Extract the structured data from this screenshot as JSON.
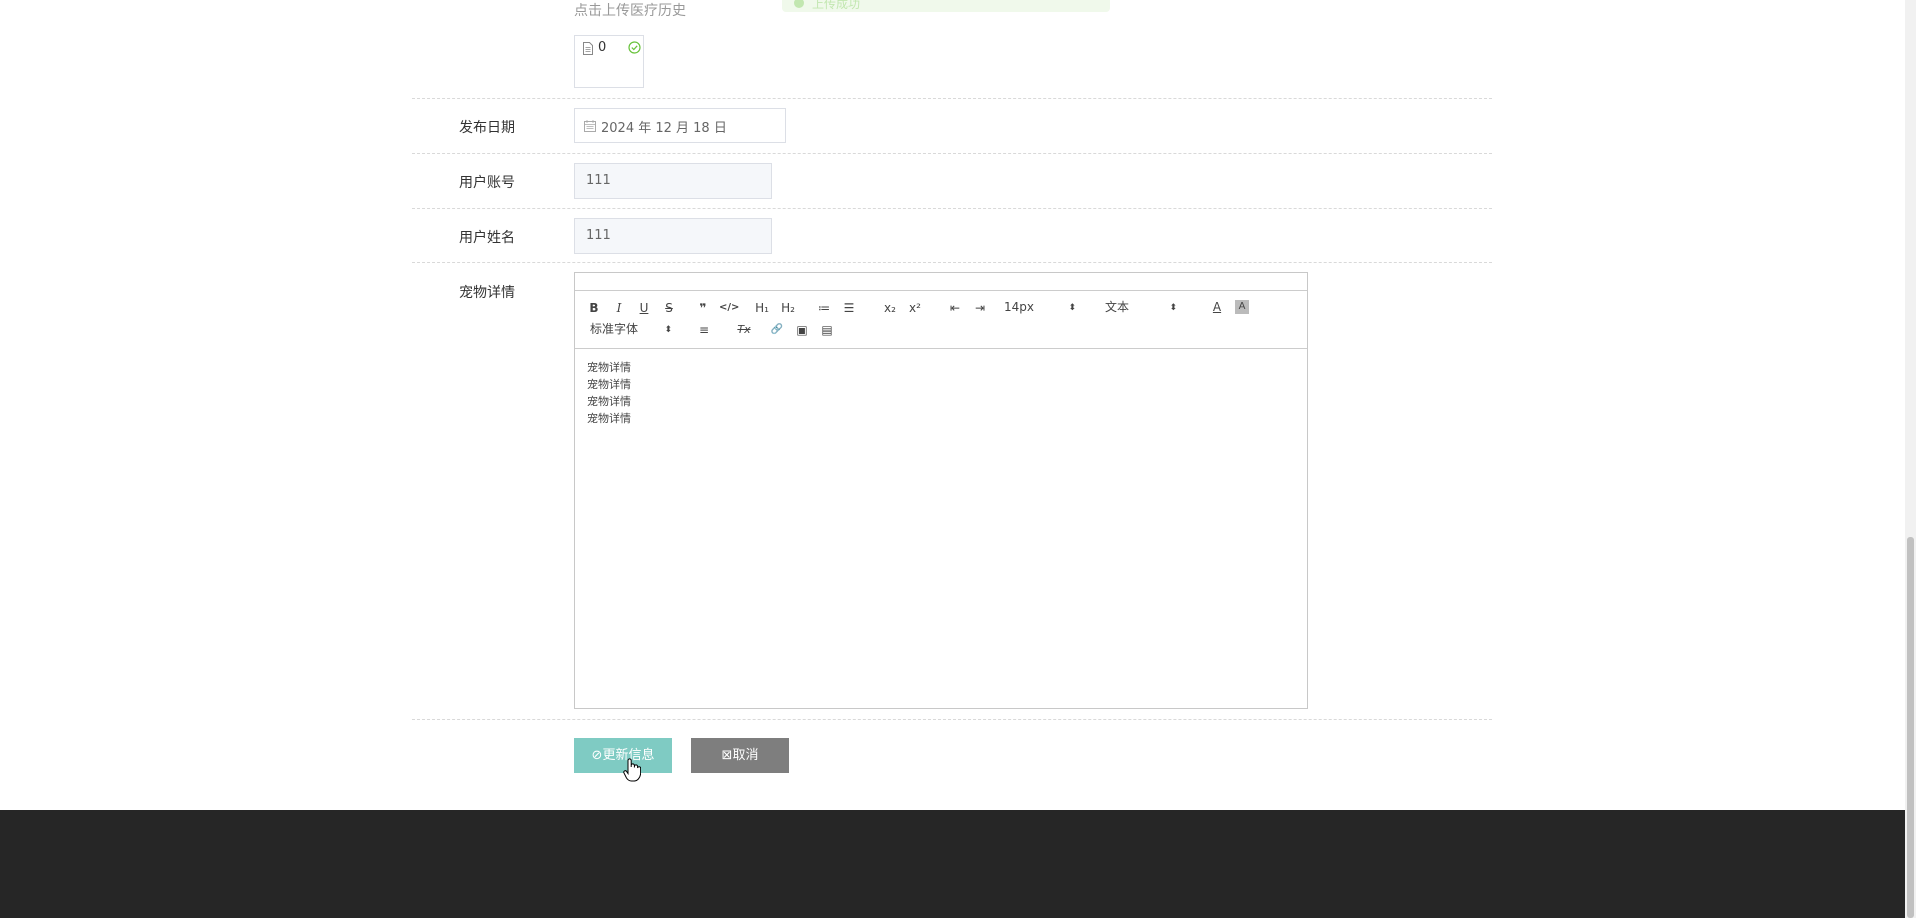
{
  "upload": {
    "hint": "点击上传医疗历史",
    "file_count": "0",
    "toast_text": "上传成功"
  },
  "fields": {
    "publish_date": {
      "label": "发布日期",
      "value": "2024 年 12 月 18 日"
    },
    "user_account": {
      "label": "用户账号",
      "value": "111"
    },
    "user_name": {
      "label": "用户姓名",
      "value": "111"
    },
    "pet_details": {
      "label": "宠物详情"
    }
  },
  "editor": {
    "toolbar": {
      "bold": "B",
      "italic": "I",
      "underline": "U",
      "strike": "S",
      "blockquote": "❞",
      "code": "</>",
      "h1": "H₁",
      "h2": "H₂",
      "ordered_list": "≔",
      "bullet_list": "☰",
      "subscript": "x₂",
      "superscript": "x²",
      "outdent": "⇤",
      "indent": "⇥",
      "size": "14px",
      "header": "文本",
      "color": "A",
      "background": "A",
      "font": "标准字体",
      "align": "≡",
      "clean": "Tx",
      "link": "🔗",
      "image": "▣",
      "video": "▤"
    },
    "content": [
      "宠物详情",
      "宠物详情",
      "宠物详情",
      "宠物详情"
    ]
  },
  "actions": {
    "update_label": "⊘更新信息",
    "cancel_label": "⊠取消"
  },
  "colors": {
    "update_button": "#7fcbc3",
    "cancel_button": "#7e7e7e",
    "footer": "#262626",
    "success": "#67c23a"
  }
}
